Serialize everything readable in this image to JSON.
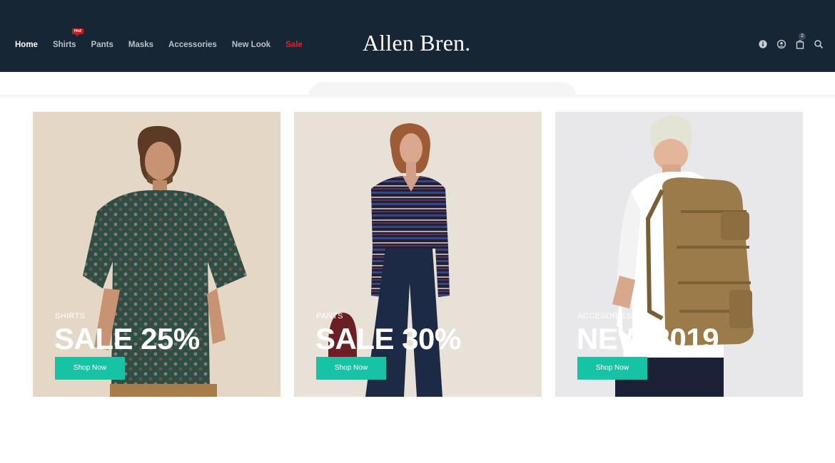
{
  "header": {
    "logo": "Allen Bren.",
    "nav": [
      {
        "label": "Home",
        "active": true
      },
      {
        "label": "Shirts",
        "badge": "Hot"
      },
      {
        "label": "Pants"
      },
      {
        "label": "Masks"
      },
      {
        "label": "Accessories"
      },
      {
        "label": "New Look"
      },
      {
        "label": "Sale",
        "highlight": "#e3202b"
      }
    ],
    "icons": [
      "info-icon",
      "user-icon",
      "cart-icon",
      "search-icon"
    ],
    "cart_count": "2",
    "background": "#172635"
  },
  "banners": [
    {
      "category": "SHIRTS",
      "headline": "SALE 25%",
      "button": "Shop Now"
    },
    {
      "category": "PANTS",
      "headline": "SALE 30%",
      "button": "Shop Now"
    },
    {
      "category": "ACCESORIES",
      "headline": "NEW 2019",
      "button": "Shop Now"
    }
  ],
  "colors": {
    "accent": "#16c4a5",
    "sale": "#e3202b",
    "badge": "#d4141c"
  }
}
